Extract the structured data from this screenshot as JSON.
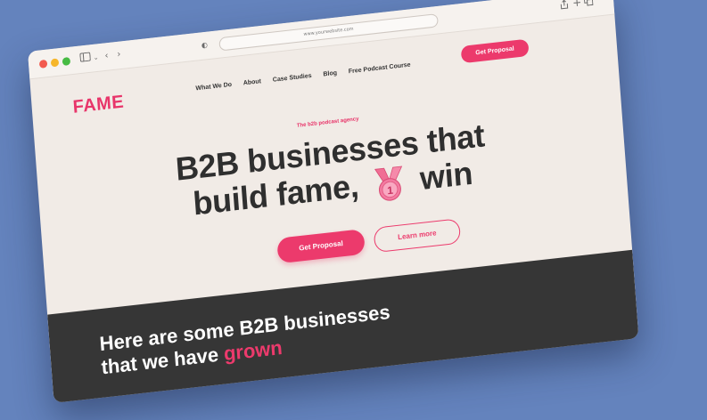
{
  "browser": {
    "url": "www.yourwebsite.com",
    "icons": [
      "sidebar-icon",
      "chevron-down-icon",
      "back-icon",
      "forward-icon",
      "shield-icon",
      "share-icon",
      "new-tab-icon",
      "tabs-overview-icon"
    ]
  },
  "header": {
    "logo": "FAME",
    "nav": [
      "What We Do",
      "About",
      "Case Studies",
      "Blog",
      "Free Podcast Course"
    ],
    "cta": "Get Proposal"
  },
  "hero": {
    "eyebrow": "The b2b podcast agency",
    "headline_line1": "B2B businesses that",
    "headline_line2_start": "build fame,",
    "headline_line2_end": "win",
    "medal_number": "1",
    "primary_cta": "Get Proposal",
    "secondary_cta": "Learn more"
  },
  "section": {
    "title_line1": "Here are some B2B businesses",
    "title_line2_start": "that we have",
    "title_accent": "grown"
  },
  "colors": {
    "background": "#6483bd",
    "page": "#f1ebe6",
    "accent": "#ec3a6c",
    "dark": "#363636",
    "text": "#2f2f2f"
  }
}
